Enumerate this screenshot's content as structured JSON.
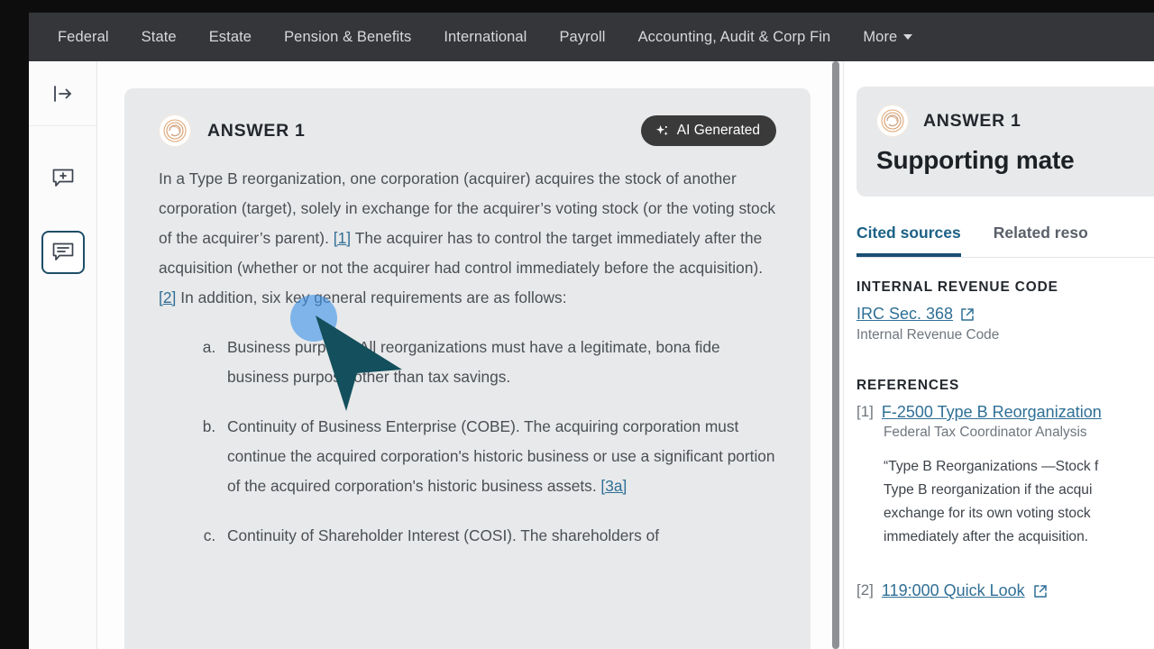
{
  "topnav": {
    "items": [
      {
        "label": "Federal"
      },
      {
        "label": "State"
      },
      {
        "label": "Estate"
      },
      {
        "label": "Pension & Benefits"
      },
      {
        "label": "International"
      },
      {
        "label": "Payroll"
      },
      {
        "label": "Accounting, Audit & Corp Fin"
      },
      {
        "label": "More"
      }
    ],
    "more_label": "More"
  },
  "rail": {
    "collapse_icon": "panel-expand-icon",
    "new_chat_icon": "new-conversation-icon",
    "history_icon": "conversation-history-icon"
  },
  "answer": {
    "avatar": "checkpoint-logo-avatar",
    "title": "ANSWER 1",
    "badge_label": "AI Generated",
    "badge_icon": "sparkle-icon",
    "paragraph_part1": "In a Type B reorganization, one corporation (acquirer) acquires the stock of another corporation (target), solely in exchange for the acquirer’s voting stock (or the voting stock of the acquirer’s parent). ",
    "citation1": "[1]",
    "paragraph_part2": " The acquirer has to control the target immediately after the acquisition (whether or not the acquirer had control immediately before the acquisition). ",
    "citation2": "[2]",
    "paragraph_part3": " In addition, six key general requirements are as follows:",
    "requirements": [
      {
        "text": "Business purpose. All reorganizations must have a legitimate, bona fide business purpose other than tax savings.",
        "citation": ""
      },
      {
        "text": "Continuity of Business Enterprise (COBE). The acquiring corporation must continue the acquired corporation's historic business or use a significant portion of the acquired corporation's historic business assets. ",
        "citation": "[3a]"
      },
      {
        "text": "Continuity of Shareholder Interest (COSI). The shareholders of",
        "citation": ""
      }
    ]
  },
  "right_panel": {
    "answer_title": "ANSWER 1",
    "subtitle": "Supporting mate",
    "tabs": [
      {
        "label": "Cited sources",
        "active": true
      },
      {
        "label": "Related reso",
        "active": false
      }
    ],
    "irc_section_title": "INTERNAL REVENUE CODE",
    "irc_link": "IRC Sec. 368",
    "irc_link_icon": "external-link-icon",
    "irc_sub": "Internal Revenue Code",
    "references_title": "REFERENCES",
    "references": [
      {
        "num": "[1]",
        "title": "F-2500 Type B Reorganization",
        "source": "Federal Tax Coordinator Analysis",
        "quote_lines": [
          "“Type B Reorganizations —Stock f",
          "Type B reorganization if the acqui",
          "exchange for its own voting stock",
          "immediately after the acquisition."
        ]
      },
      {
        "num": "[2]",
        "title": "119:000 Quick Look",
        "link_icon": "external-link-icon",
        "source": "",
        "quote_lines": []
      }
    ]
  },
  "cursor": {
    "pointer": "mouse-cursor-arrow",
    "click_indicator": "click-highlight-circle"
  },
  "colors": {
    "nav_bg": "#35363a",
    "card_bg": "#e8e9ea",
    "link": "#2f6f96",
    "tab_active": "#1a4e72",
    "badge_bg": "#3a3a3a",
    "cursor": "#134f5c",
    "click_halo": "#3d93e8"
  }
}
